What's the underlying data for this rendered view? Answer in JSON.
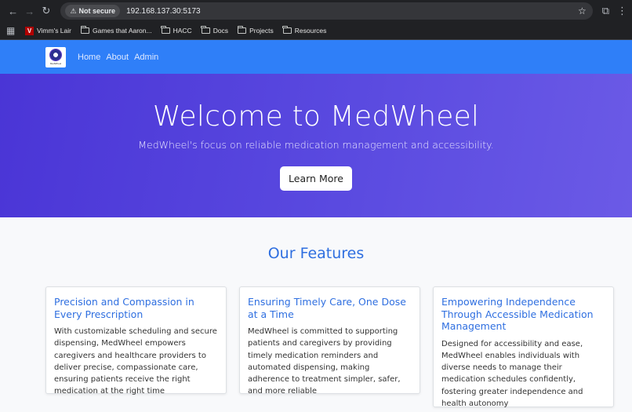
{
  "browser": {
    "secure_label": "Not secure",
    "url": "192.168.137.30:5173",
    "bookmarks": [
      {
        "label": "Vimm's Lair",
        "icon": "vimm-icon"
      },
      {
        "label": "Games that Aaron...",
        "icon": "folder-icon"
      },
      {
        "label": "HACC",
        "icon": "folder-icon"
      },
      {
        "label": "Docs",
        "icon": "folder-icon"
      },
      {
        "label": "Projects",
        "icon": "folder-icon"
      },
      {
        "label": "Resources",
        "icon": "folder-icon"
      }
    ]
  },
  "nav": {
    "links": [
      "Home",
      "About",
      "Admin"
    ],
    "logo_text": "MedWheel",
    "color": "#2f7ff8"
  },
  "hero": {
    "title": "Welcome to MedWheel",
    "subtitle": "MedWheel's focus on reliable medication management and accessibility.",
    "button": "Learn More",
    "gradient_start": "#4a35d6",
    "gradient_end": "#6b5ae6"
  },
  "features": {
    "heading": "Our Features",
    "cards": [
      {
        "title": "Precision and Compassion in Every Prescription",
        "body": "With customizable scheduling and secure dispensing, MedWheel empowers caregivers and healthcare providers to deliver precise, compassionate care, ensuring patients receive the right medication at the right time"
      },
      {
        "title": "Ensuring Timely Care, One Dose at a Time",
        "body": "MedWheel is committed to supporting patients and caregivers by providing timely medication reminders and automated dispensing, making adherence to treatment simpler, safer, and more reliable"
      },
      {
        "title": "Empowering Independence Through Accessible Medication Management",
        "body": "Designed for accessibility and ease, MedWheel enables individuals with diverse needs to manage their medication schedules confidently, fostering greater independence and health autonomy"
      }
    ],
    "accent": "#2f6fe0"
  }
}
